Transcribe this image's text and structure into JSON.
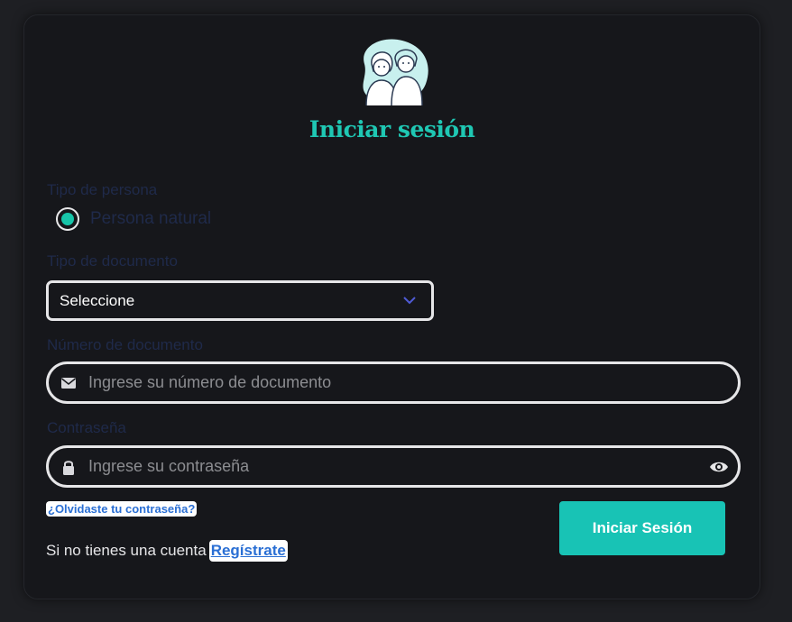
{
  "title": "Iniciar sesión",
  "avatar_icon": "couple-avatar-icon",
  "person_type": {
    "label": "Tipo de persona",
    "option_label": "Persona natural",
    "selected": true
  },
  "document_type": {
    "label": "Tipo de documento",
    "value": "Seleccione"
  },
  "document_number": {
    "label": "Número de documento",
    "placeholder": "Ingrese su número de documento",
    "value": "",
    "icon": "envelope-icon"
  },
  "password": {
    "label": "Contraseña",
    "placeholder": "Ingrese su contraseña",
    "value": "",
    "icon": "lock-icon",
    "toggle_icon": "eye-icon"
  },
  "forgot_link": "¿Olvidaste tu contraseña?",
  "no_account_text": "Si no tienes una cuenta",
  "register_link": "Regístrate",
  "submit_label": "Iniciar Sesión",
  "colors": {
    "accent": "#18c3b5",
    "background": "#16171b",
    "link": "#2a6fd4",
    "label_dark": "#1f2a4a"
  }
}
